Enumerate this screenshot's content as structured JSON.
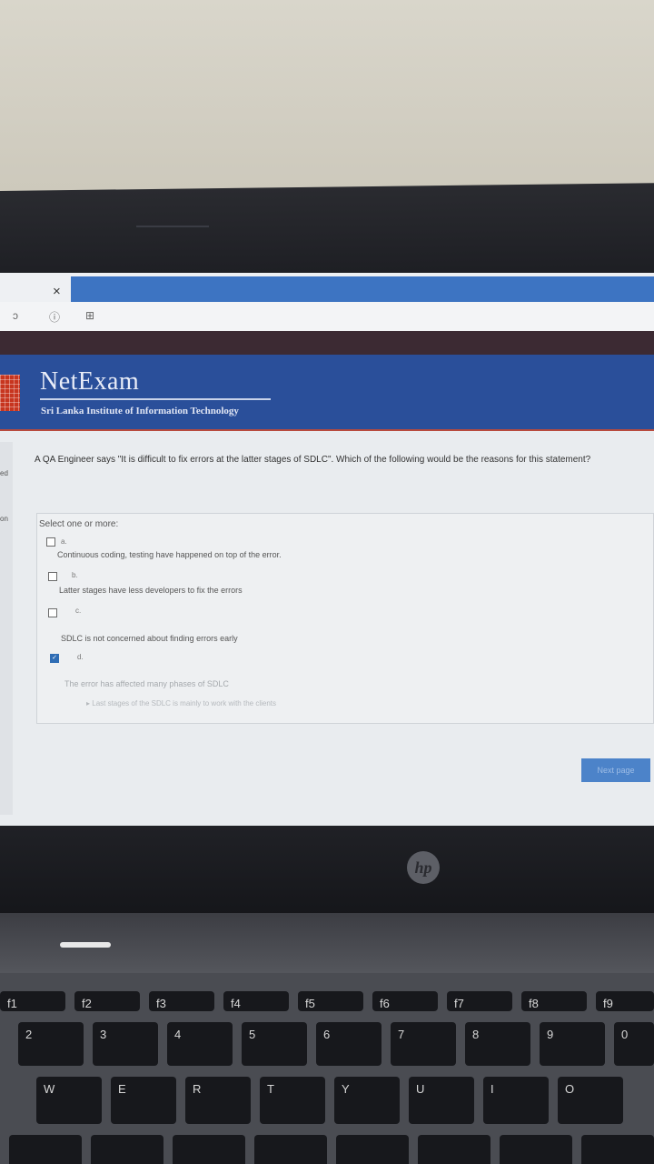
{
  "browser": {
    "close_glyph": "×",
    "addr_icons": [
      "ↄ",
      "ⓘ",
      "⊞"
    ]
  },
  "header": {
    "brand": "NetExam",
    "subtitle": "Sri Lanka Institute of Information Technology"
  },
  "sidebar": {
    "label_1": "ed",
    "label_2": "on"
  },
  "question": {
    "text": "A QA Engineer says \"It is difficult to fix errors at the latter stages of SDLC\". Which of the following would be the reasons for this statement?",
    "select_label": "Select one or more:",
    "options": [
      {
        "letter": "a.",
        "text": "Continuous coding, testing have happened on top of the error.",
        "checked": false
      },
      {
        "letter": "b.",
        "text": "Latter stages have less developers to fix the errors",
        "checked": false
      },
      {
        "letter": "c.",
        "text": "SDLC is not concerned about finding errors early",
        "checked": false
      },
      {
        "letter": "d.",
        "text": "The error has affected many phases of SDLC",
        "checked": true
      }
    ],
    "feedback": "▸ Last stages of the SDLC is mainly to work with the clients",
    "next_label": "Next page"
  },
  "laptop": {
    "brand_glyph": "hp"
  },
  "keyboard": {
    "row1": [
      "f1",
      "f2",
      "f3",
      "f4",
      "f5",
      "f6",
      "f7",
      "f8",
      "f9"
    ],
    "row2": [
      "2",
      "3",
      "4",
      "5",
      "6",
      "7",
      "8",
      "9",
      "0"
    ],
    "row3": [
      "W",
      "E",
      "R",
      "T",
      "Y",
      "U",
      "I",
      "O"
    ]
  }
}
